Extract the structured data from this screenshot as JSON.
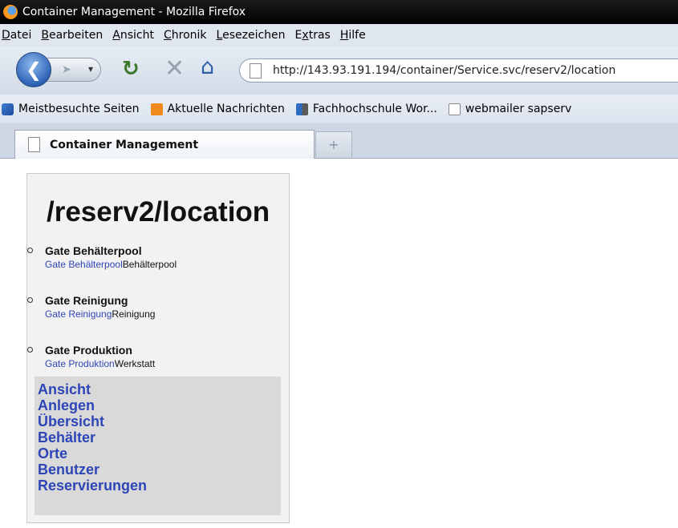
{
  "window": {
    "title": "Container Management - Mozilla Firefox"
  },
  "menu": {
    "items": [
      {
        "accel": "D",
        "rest": "atei"
      },
      {
        "accel": "B",
        "rest": "earbeiten"
      },
      {
        "accel": "A",
        "rest": "nsicht"
      },
      {
        "accel": "C",
        "rest": "hronik"
      },
      {
        "accel": "L",
        "rest": "esezeichen"
      },
      {
        "pre": "E",
        "accel": "x",
        "rest": "tras"
      },
      {
        "accel": "H",
        "rest": "ilfe"
      }
    ]
  },
  "nav": {
    "url": "http://143.93.191.194/container/Service.svc/reserv2/location"
  },
  "bookmarks": [
    {
      "icon": "search-icon",
      "label": "Meistbesuchte Seiten"
    },
    {
      "icon": "rss-icon",
      "label": "Aktuelle Nachrichten"
    },
    {
      "icon": "site-icon",
      "label": "Fachhochschule Wor..."
    },
    {
      "icon": "page-icon",
      "label": "webmailer sapserv"
    }
  ],
  "tab": {
    "label": "Container Management"
  },
  "panel": {
    "title": "/reserv2/location",
    "locations": [
      {
        "name": "Gate Behälterpool",
        "link": "Gate Behälterpool",
        "suffix": "Behälterpool"
      },
      {
        "name": "Gate Reinigung",
        "link": "Gate Reinigung",
        "suffix": "Reinigung"
      },
      {
        "name": "Gate Produktion",
        "link": "Gate Produktion",
        "suffix": "Werkstatt"
      }
    ],
    "nav_links": [
      "Ansicht",
      "Anlegen",
      "Übersicht",
      "Behälter",
      "Orte",
      "Benutzer",
      "Reservierungen"
    ]
  }
}
